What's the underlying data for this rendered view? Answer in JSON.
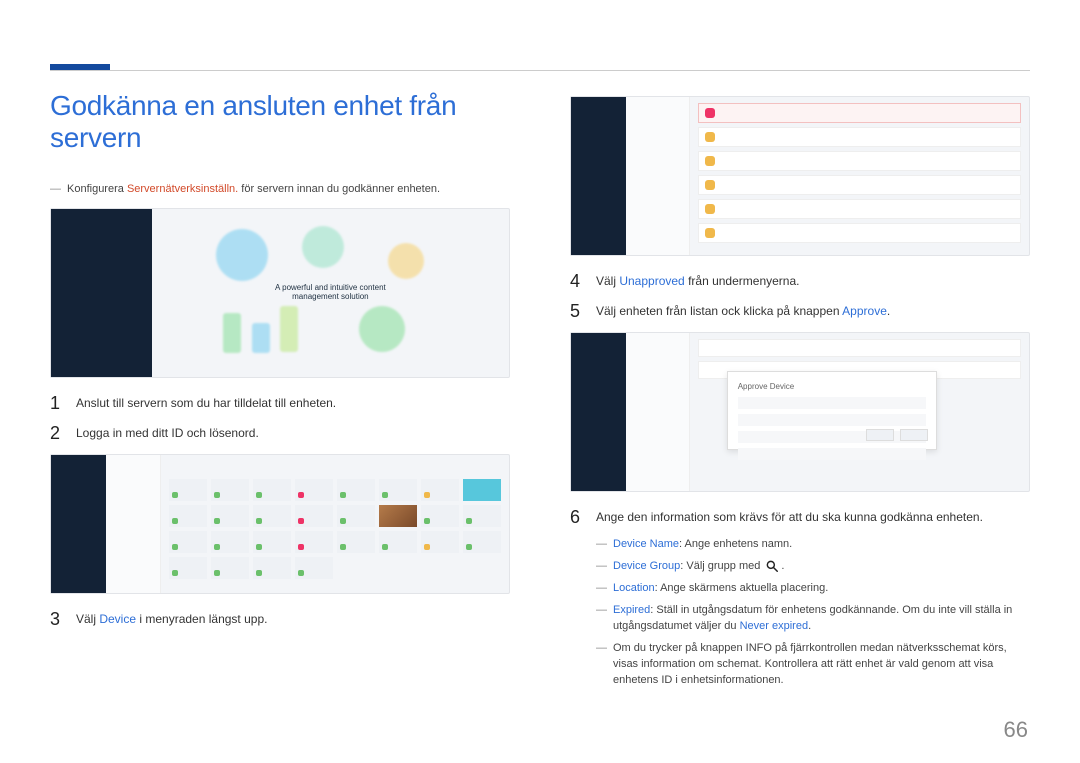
{
  "page_number": "66",
  "heading": "Godkänna en ansluten enhet från servern",
  "intro_note": {
    "prefix": "Konfigurera ",
    "keyword": "Servernätverksinställn.",
    "suffix": " för servern innan du godkänner enheten."
  },
  "img1_caption_line1": "A powerful and intuitive content",
  "img1_caption_line2": "management solution",
  "steps": {
    "s1": {
      "num": "1",
      "text": "Anslut till servern som du har tilldelat till enheten."
    },
    "s2": {
      "num": "2",
      "text": "Logga in med ditt ID och lösenord."
    },
    "s3": {
      "num": "3",
      "pre": "Välj ",
      "kw": "Device",
      "post": " i menyraden längst upp."
    },
    "s4": {
      "num": "4",
      "pre": "Välj ",
      "kw": "Unapproved",
      "post": " från undermenyerna."
    },
    "s5": {
      "num": "5",
      "pre": "Välj enheten från listan ock klicka på knappen ",
      "kw": "Approve",
      "post": "."
    },
    "s6": {
      "num": "6",
      "text": "Ange den information som krävs för att du ska kunna godkänna enheten."
    }
  },
  "sub": {
    "device_name": {
      "kw": "Device Name",
      "text": ": Ange enhetens namn."
    },
    "device_group": {
      "kw": "Device Group",
      "text1": ": Välj grupp med ",
      "text2": "."
    },
    "location": {
      "kw": "Location",
      "text": ": Ange skärmens aktuella placering."
    },
    "expired": {
      "kw": "Expired",
      "text1": ": Ställ in utgångsdatum för enhetens godkännande. Om du inte vill ställa in utgångsdatumet väljer du ",
      "kw2": "Never expired",
      "text2": "."
    },
    "info_note": "Om du trycker på knappen INFO på fjärrkontrollen medan nätverksschemat körs, visas information om schemat. Kontrollera att rätt enhet är vald genom att visa enhetens ID i enhetsinformationen."
  },
  "modal_title": "Approve Device"
}
